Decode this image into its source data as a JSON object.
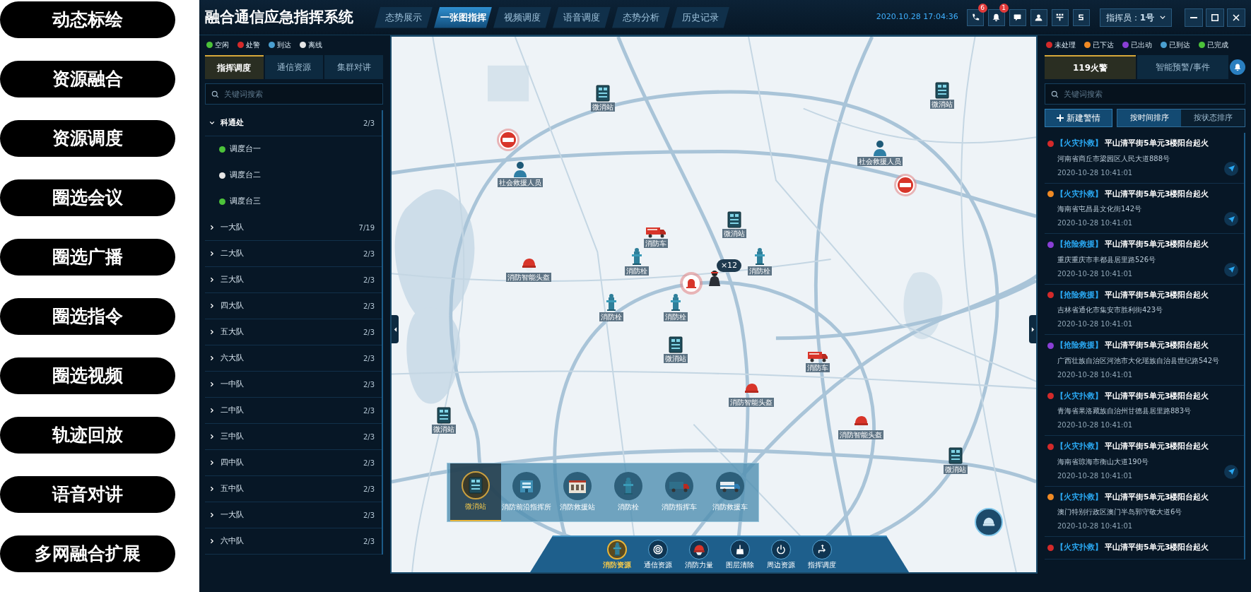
{
  "feature_labels": [
    "动态标绘",
    "资源融合",
    "资源调度",
    "圈选会议",
    "圈选广播",
    "圈选指令",
    "圈选视频",
    "轨迹回放",
    "语音对讲",
    "多网融合扩展"
  ],
  "header": {
    "title": "融合通信应急指挥系统",
    "nav_tabs": [
      {
        "label": "态势展示",
        "selected": false
      },
      {
        "label": "一张图指挥",
        "selected": true
      },
      {
        "label": "视频调度",
        "selected": false
      },
      {
        "label": "语音调度",
        "selected": false
      },
      {
        "label": "态势分析",
        "selected": false
      },
      {
        "label": "历史记录",
        "selected": false
      }
    ],
    "datetime": "2020.10.28 17:04:36",
    "tools": [
      {
        "kind": "phone",
        "badge": "6"
      },
      {
        "kind": "bell",
        "badge": "1"
      },
      {
        "kind": "message"
      },
      {
        "kind": "contacts"
      },
      {
        "kind": "keypad"
      },
      {
        "kind": "script"
      }
    ],
    "operator": "指挥员：**1号**"
  },
  "left_panel": {
    "legend": [
      {
        "label": "空闲",
        "color": "#4cc23a"
      },
      {
        "label": "处警",
        "color": "#d42a2a"
      },
      {
        "label": "到达",
        "color": "#4a9fd0"
      },
      {
        "label": "离线",
        "color": "#e6e6e6"
      }
    ],
    "tabs": [
      {
        "label": "指挥调度",
        "selected": true
      },
      {
        "label": "通信资源",
        "selected": false
      },
      {
        "label": "集群对讲",
        "selected": false
      }
    ],
    "search": {
      "placeholder": "关键词搜索"
    },
    "tree": [
      {
        "label": "科通处",
        "count": "2/3",
        "expanded": true,
        "children": [
          {
            "label": "调度台一",
            "color": "#4cc23a"
          },
          {
            "label": "调度台二",
            "color": "#e6e6e6"
          },
          {
            "label": "调度台三",
            "color": "#4cc23a"
          }
        ]
      },
      {
        "label": "一大队",
        "count": "7/19",
        "expanded": false
      },
      {
        "label": "二大队",
        "count": "2/3",
        "expanded": false
      },
      {
        "label": "三大队",
        "count": "2/3",
        "expanded": false
      },
      {
        "label": "四大队",
        "count": "2/3",
        "expanded": false
      },
      {
        "label": "五大队",
        "count": "2/3",
        "expanded": false
      },
      {
        "label": "六大队",
        "count": "2/3",
        "expanded": false
      },
      {
        "label": "一中队",
        "count": "2/3",
        "expanded": false
      },
      {
        "label": "二中队",
        "count": "2/3",
        "expanded": false
      },
      {
        "label": "三中队",
        "count": "2/3",
        "expanded": false
      },
      {
        "label": "四中队",
        "count": "2/3",
        "expanded": false
      },
      {
        "label": "五中队",
        "count": "2/3",
        "expanded": false
      },
      {
        "label": "一大队",
        "count": "2/3",
        "expanded": false
      },
      {
        "label": "六中队",
        "count": "2/3",
        "expanded": false
      }
    ]
  },
  "map": {
    "markers": [
      {
        "kind": "station",
        "label": "微消站"
      },
      {
        "kind": "station",
        "label": "微消站"
      },
      {
        "kind": "sensor"
      },
      {
        "kind": "rescuer",
        "label": "社会救援人员"
      },
      {
        "kind": "rescuer",
        "label": "社会救援人员"
      },
      {
        "kind": "sensor"
      },
      {
        "kind": "station",
        "label": "微消站"
      },
      {
        "kind": "truck",
        "label": "消防车"
      },
      {
        "kind": "helmet",
        "label": "消防智能头盔"
      },
      {
        "kind": "hydrant",
        "label": "消防栓"
      },
      {
        "kind": "hydrant",
        "label": "消防栓"
      },
      {
        "kind": "alarm"
      },
      {
        "kind": "firefighter",
        "badge": "×12"
      },
      {
        "kind": "hydrant",
        "label": "消防栓"
      },
      {
        "kind": "hydrant",
        "label": "消防栓"
      },
      {
        "kind": "station",
        "label": "微消站"
      },
      {
        "kind": "truck",
        "label": "消防车"
      },
      {
        "kind": "helmet",
        "label": "消防智能头盔"
      },
      {
        "kind": "helmet",
        "label": "消防智能头盔"
      },
      {
        "kind": "station",
        "label": "微消站"
      },
      {
        "kind": "station",
        "label": "微消站"
      }
    ],
    "layers": [
      {
        "kind": "station",
        "label": "微消站",
        "selected": true
      },
      {
        "kind": "post",
        "label": "消防前沿指挥所",
        "selected": false
      },
      {
        "kind": "building",
        "label": "消防救援站",
        "selected": false
      },
      {
        "kind": "hydrant",
        "label": "消防栓",
        "selected": false
      },
      {
        "kind": "command_truck",
        "label": "消防指挥车",
        "selected": false
      },
      {
        "kind": "rescue_truck",
        "label": "消防救援车",
        "selected": false
      }
    ],
    "toolbar": [
      {
        "kind": "hydrant",
        "label": "消防资源",
        "selected": true
      },
      {
        "kind": "signal",
        "label": "通信资源",
        "selected": false
      },
      {
        "kind": "helmet",
        "label": "消防力量",
        "selected": false
      },
      {
        "kind": "broom",
        "label": "图层清除",
        "selected": false
      },
      {
        "kind": "power",
        "label": "周边资源",
        "selected": false
      },
      {
        "kind": "route",
        "label": "指挥调度",
        "selected": false
      }
    ]
  },
  "right_panel": {
    "legend": [
      {
        "label": "未处理",
        "color": "#d42a2a"
      },
      {
        "label": "已下达",
        "color": "#f08a24"
      },
      {
        "label": "已出动",
        "color": "#8a3fd6"
      },
      {
        "label": "已到达",
        "color": "#4a9fd0"
      },
      {
        "label": "已完成",
        "color": "#4cc23a"
      }
    ],
    "tabs": [
      {
        "label": "119火警",
        "selected": true
      },
      {
        "label": "智能预警/事件",
        "selected": false
      }
    ],
    "search": {
      "placeholder": "关键词搜索"
    },
    "new_button": "新建警情",
    "sort_options": [
      {
        "label": "按时间排序",
        "selected": true
      },
      {
        "label": "按状态排序",
        "selected": false
      }
    ],
    "incidents": [
      {
        "color": "#d42a2a",
        "tag": "【火灾扑救】",
        "title": "平山清平街5单元3楼阳台起火",
        "address": "河南省商丘市梁园区人民大道888号",
        "time": "2020-10-28 10:41:01",
        "locate": true
      },
      {
        "color": "#f08a24",
        "tag": "【火灾扑救】",
        "title": "平山清平街5单元3楼阳台起火",
        "address": "海南省屯昌县文化街142号",
        "time": "2020-10-28 10:41:01",
        "locate": true
      },
      {
        "color": "#8a3fd6",
        "tag": "【抢险救援】",
        "title": "平山清平街5单元3楼阳台起火",
        "address": "重庆重庆市丰都县居里路526号",
        "time": "2020-10-28 10:41:01",
        "locate": true
      },
      {
        "color": "#d42a2a",
        "tag": "【抢险救援】",
        "title": "平山清平街5单元3楼阳台起火",
        "address": "吉林省通化市集安市胜利街423号",
        "time": "2020-10-28 10:41:01",
        "locate": false
      },
      {
        "color": "#8a3fd6",
        "tag": "【抢险救援】",
        "title": "平山清平街5单元3楼阳台起火",
        "address": "广西壮族自治区河池市大化瑶族自治县世纪路542号",
        "time": "2020-10-28 10:41:01",
        "locate": false
      },
      {
        "color": "#d42a2a",
        "tag": "【火灾扑救】",
        "title": "平山清平街5单元3楼阳台起火",
        "address": "青海省果洛藏族自治州甘德县居里路883号",
        "time": "2020-10-28 10:41:01",
        "locate": false
      },
      {
        "color": "#d42a2a",
        "tag": "【火灾扑救】",
        "title": "平山清平街5单元3楼阳台起火",
        "address": "海南省琼海市衡山大道190号",
        "time": "2020-10-28 10:41:01",
        "locate": true
      },
      {
        "color": "#f08a24",
        "tag": "【火灾扑救】",
        "title": "平山清平街5单元3楼阳台起火",
        "address": "澳门特别行政区澳门半岛郭守敬大道6号",
        "time": "2020-10-28 10:41:01",
        "locate": false
      },
      {
        "color": "#d42a2a",
        "tag": "【火灾扑救】",
        "title": "平山清平街5单元3楼阳台起火",
        "locate": false
      }
    ]
  }
}
